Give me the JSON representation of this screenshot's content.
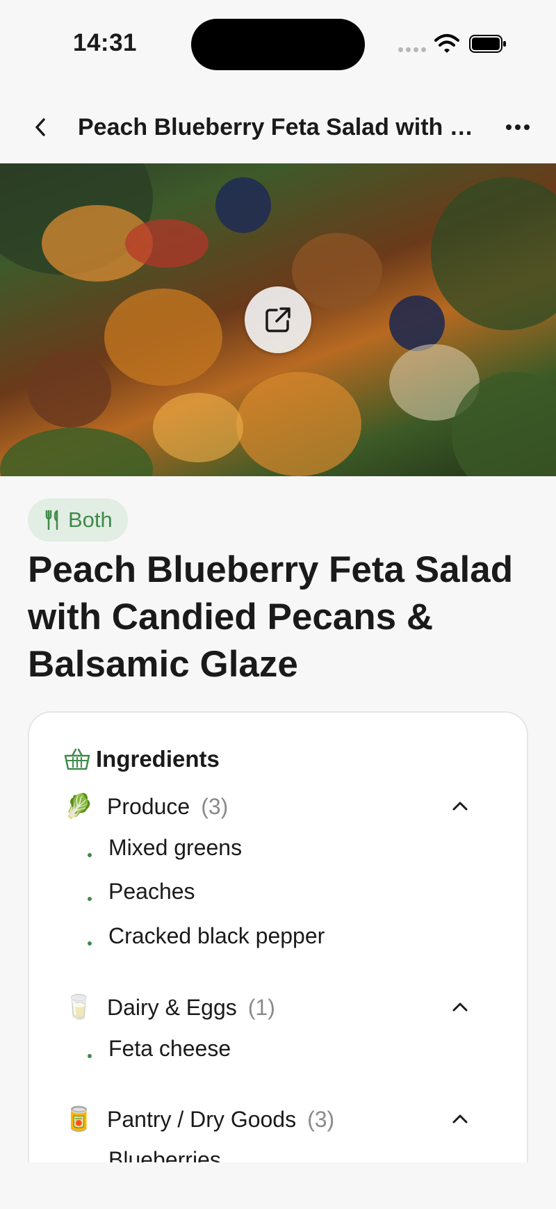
{
  "status": {
    "time": "14:31"
  },
  "nav": {
    "title": "Peach Blueberry Feta Salad with C..."
  },
  "badge": {
    "label": "Both"
  },
  "recipe": {
    "title": "Peach Blueberry Feta Salad with Candied Pecans & Balsamic Glaze"
  },
  "ingredients": {
    "heading": "Ingredients",
    "groups": [
      {
        "emoji": "🥬",
        "name": "Produce",
        "count": "(3)",
        "items": [
          "Mixed greens",
          "Peaches",
          "Cracked black pepper"
        ]
      },
      {
        "emoji": "🥛",
        "name": "Dairy & Eggs",
        "count": "(1)",
        "items": [
          "Feta cheese"
        ]
      },
      {
        "emoji": "🥫",
        "name": "Pantry / Dry Goods",
        "count": "(3)",
        "items": [
          "Blueberries"
        ]
      }
    ]
  },
  "colors": {
    "accent": "#3f8a4a",
    "badge_bg": "#e2ede3",
    "background": "#f7f7f7"
  }
}
